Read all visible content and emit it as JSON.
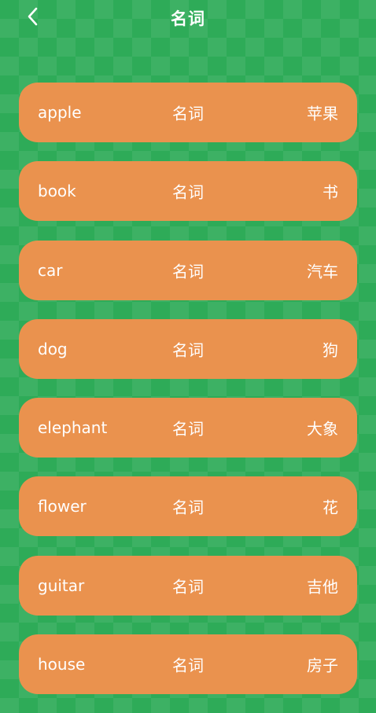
{
  "header": {
    "title": "名词",
    "back_icon": "chevron-left-icon"
  },
  "colors": {
    "background": "#2eab58",
    "card": "#ea924e",
    "text": "#ffffff"
  },
  "words": [
    {
      "en": "apple",
      "pos": "名词",
      "zh": "苹果"
    },
    {
      "en": "book",
      "pos": "名词",
      "zh": "书"
    },
    {
      "en": "car",
      "pos": "名词",
      "zh": "汽车"
    },
    {
      "en": "dog",
      "pos": "名词",
      "zh": "狗"
    },
    {
      "en": "elephant",
      "pos": "名词",
      "zh": "大象"
    },
    {
      "en": "flower",
      "pos": "名词",
      "zh": "花"
    },
    {
      "en": "guitar",
      "pos": "名词",
      "zh": "吉他"
    },
    {
      "en": "house",
      "pos": "名词",
      "zh": "房子"
    }
  ]
}
